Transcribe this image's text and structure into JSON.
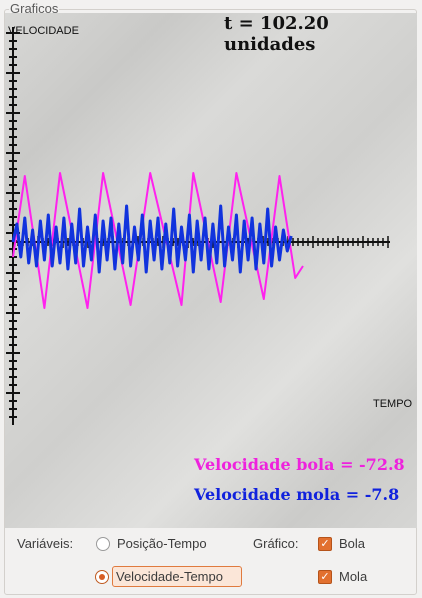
{
  "panel": {
    "title": "Graficos"
  },
  "plot": {
    "ylabel": "VELOCIDADE",
    "xlabel": "TEMPO",
    "time_readout": "t = 102.20 unidades",
    "readouts": {
      "bola": {
        "text": "Velocidade bola = -72.8",
        "color": "#ee22dd"
      },
      "mola": {
        "text": "Velocidade mola = -7.8",
        "color": "#1122dd"
      }
    },
    "colors": {
      "bola": "#ff22ee",
      "mola": "#1133dd",
      "axis": "#111111"
    }
  },
  "controls": {
    "variables_label": "Variáveis:",
    "graph_label": "Gráfico:",
    "radios": [
      {
        "label": "Posição-Tempo",
        "checked": false
      },
      {
        "label": "Velocidade-Tempo",
        "checked": true
      }
    ],
    "checkboxes": [
      {
        "label": "Bola",
        "checked": true
      },
      {
        "label": "Mola",
        "checked": true
      }
    ]
  },
  "chart_data": {
    "type": "line",
    "xlabel": "TEMPO",
    "ylabel": "VELOCIDADE",
    "series": [
      {
        "name": "bola",
        "color": "#ff22ee",
        "points": [
          [
            0,
            -25
          ],
          [
            3,
            110
          ],
          [
            8,
            -110
          ],
          [
            12,
            115
          ],
          [
            19,
            -110
          ],
          [
            23,
            115
          ],
          [
            30,
            -105
          ],
          [
            35,
            115
          ],
          [
            43,
            -105
          ],
          [
            46,
            115
          ],
          [
            53,
            -100
          ],
          [
            57,
            115
          ],
          [
            64,
            -95
          ],
          [
            68,
            110
          ],
          [
            72,
            -60
          ],
          [
            74,
            -40
          ]
        ]
      },
      {
        "name": "mola",
        "color": "#1133dd",
        "description_points": "oscillating around 0 with amplitude ~40, spikes to ~60",
        "points": [
          [
            0,
            0
          ],
          [
            1,
            30
          ],
          [
            2,
            -25
          ],
          [
            3,
            40
          ],
          [
            4,
            -35
          ],
          [
            5,
            20
          ],
          [
            6,
            -40
          ],
          [
            7,
            35
          ],
          [
            8,
            -30
          ],
          [
            9,
            45
          ],
          [
            10,
            -40
          ],
          [
            11,
            25
          ],
          [
            12,
            -35
          ],
          [
            13,
            40
          ],
          [
            14,
            -45
          ],
          [
            15,
            30
          ],
          [
            16,
            -35
          ],
          [
            17,
            55
          ],
          [
            18,
            -40
          ],
          [
            19,
            25
          ],
          [
            20,
            -30
          ],
          [
            21,
            45
          ],
          [
            22,
            -50
          ],
          [
            23,
            35
          ],
          [
            24,
            -30
          ],
          [
            25,
            40
          ],
          [
            26,
            -45
          ],
          [
            27,
            30
          ],
          [
            28,
            -35
          ],
          [
            29,
            60
          ],
          [
            30,
            -40
          ],
          [
            31,
            25
          ],
          [
            32,
            -30
          ],
          [
            33,
            45
          ],
          [
            34,
            -50
          ],
          [
            35,
            35
          ],
          [
            36,
            -30
          ],
          [
            37,
            40
          ],
          [
            38,
            -45
          ],
          [
            39,
            30
          ],
          [
            40,
            -35
          ],
          [
            41,
            55
          ],
          [
            42,
            -40
          ],
          [
            43,
            25
          ],
          [
            44,
            -30
          ],
          [
            45,
            45
          ],
          [
            46,
            -50
          ],
          [
            47,
            35
          ],
          [
            48,
            -30
          ],
          [
            49,
            40
          ],
          [
            50,
            -45
          ],
          [
            51,
            30
          ],
          [
            52,
            -35
          ],
          [
            53,
            60
          ],
          [
            54,
            -40
          ],
          [
            55,
            25
          ],
          [
            56,
            -30
          ],
          [
            57,
            45
          ],
          [
            58,
            -50
          ],
          [
            59,
            35
          ],
          [
            60,
            -30
          ],
          [
            61,
            40
          ],
          [
            62,
            -45
          ],
          [
            63,
            30
          ],
          [
            64,
            -35
          ],
          [
            65,
            55
          ],
          [
            66,
            -40
          ],
          [
            67,
            25
          ],
          [
            68,
            -30
          ],
          [
            69,
            20
          ],
          [
            70,
            -15
          ],
          [
            71,
            10
          ]
        ]
      }
    ]
  }
}
